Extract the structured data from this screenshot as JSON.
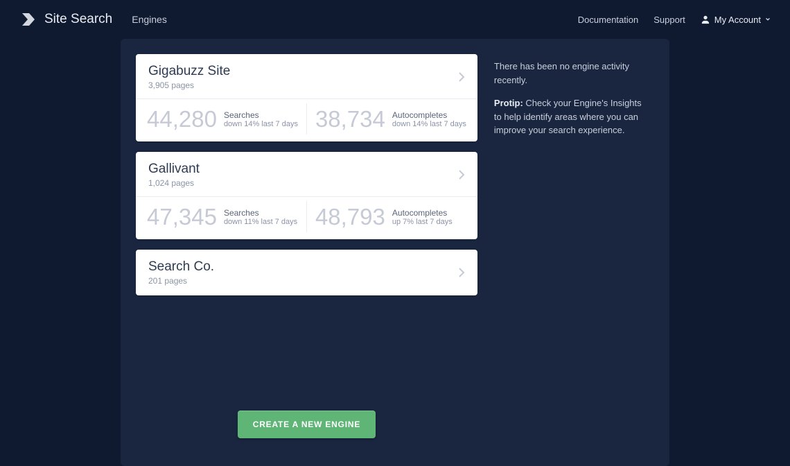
{
  "header": {
    "brand": "Site Search",
    "nav": "Engines",
    "documentation": "Documentation",
    "support": "Support",
    "account": "My Account"
  },
  "engines": [
    {
      "name": "Gigabuzz Site",
      "pages": "3,905 pages",
      "searches_value": "44,280",
      "searches_label": "Searches",
      "searches_trend": "down 14% last 7 days",
      "auto_value": "38,734",
      "auto_label": "Autocompletes",
      "auto_trend": "down 14% last 7 days"
    },
    {
      "name": "Gallivant",
      "pages": "1,024 pages",
      "searches_value": "47,345",
      "searches_label": "Searches",
      "searches_trend": "down 11% last 7 days",
      "auto_value": "48,793",
      "auto_label": "Autocompletes",
      "auto_trend": "up 7% last 7 days"
    },
    {
      "name": "Search Co.",
      "pages": "201 pages"
    }
  ],
  "sidebar": {
    "notice": "There has been no engine activity recently.",
    "protip_label": "Protip:",
    "protip_text": " Check your Engine's Insights to help identify areas where you can improve your search experience."
  },
  "cta": "CREATE A NEW ENGINE"
}
